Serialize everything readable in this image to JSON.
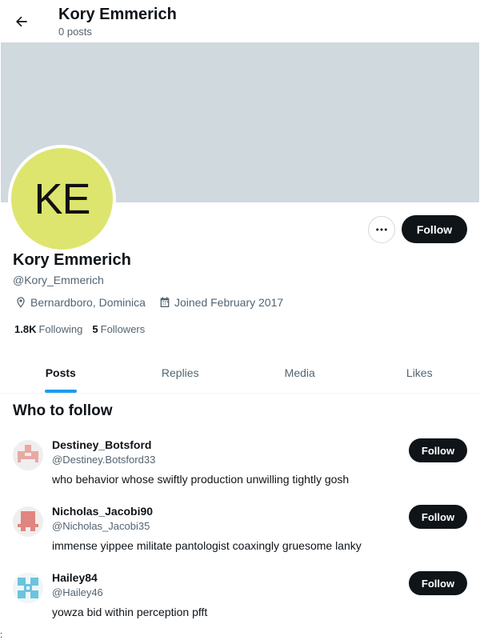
{
  "header": {
    "title": "Kory Emmerich",
    "post_count": "0 posts",
    "back_icon": "arrow-left-icon"
  },
  "banner": {
    "color": "#cfd9de"
  },
  "profile": {
    "avatar_initials": "KE",
    "avatar_color": "#dde56f",
    "name": "Kory Emmerich",
    "handle": "@Kory_Emmerich",
    "location": "Bernardboro, Dominica",
    "joined": "Joined February 2017",
    "following_count": "1.8K",
    "following_label": "Following",
    "followers_count": "5",
    "followers_label": "Followers",
    "more_icon": "more-horizontal-icon",
    "follow_label": "Follow"
  },
  "tabs": [
    {
      "label": "Posts",
      "active": true
    },
    {
      "label": "Replies",
      "active": false
    },
    {
      "label": "Media",
      "active": false
    },
    {
      "label": "Likes",
      "active": false
    }
  ],
  "who_to_follow": {
    "title": "Who to follow",
    "users": [
      {
        "name": "Destiney_Botsford",
        "handle": "@Destiney.Botsford33",
        "bio": "who behavior whose swiftly production unwilling tightly gosh",
        "follow_label": "Follow",
        "avatar_color": "#e8a8a4"
      },
      {
        "name": "Nicholas_Jacobi90",
        "handle": "@Nicholas_Jacobi35",
        "bio": "immense yippee militate pantologist coaxingly gruesome lanky",
        "follow_label": "Follow",
        "avatar_color": "#e0857f"
      },
      {
        "name": "Hailey84",
        "handle": "@Hailey46",
        "bio": "yowza bid within perception pfft",
        "follow_label": "Follow",
        "avatar_color": "#6cc3dd"
      }
    ]
  },
  "corner_mark": ":",
  "colors": {
    "accent": "#1d9bf0",
    "text": "#0f1419",
    "muted": "#536471"
  }
}
